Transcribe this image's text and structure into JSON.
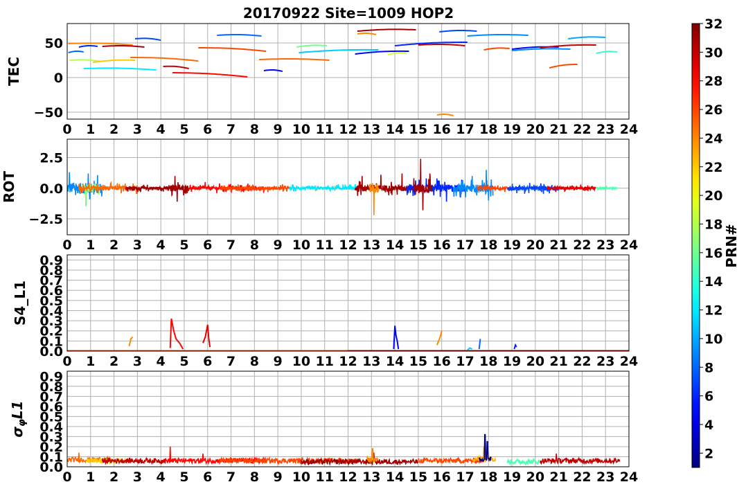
{
  "chart_data": {
    "type": "line",
    "title": "20170922 Site=1009 HOP2",
    "xlim": [
      0,
      24
    ],
    "x_ticks": [
      "0",
      "1",
      "2",
      "3",
      "4",
      "5",
      "6",
      "7",
      "8",
      "9",
      "10",
      "11",
      "12",
      "13",
      "14",
      "15",
      "16",
      "17",
      "18",
      "19",
      "20",
      "21",
      "22",
      "23",
      "24"
    ],
    "grid": true,
    "colorbar": {
      "label": "PRN#",
      "range": [
        1,
        32
      ],
      "ticks": [
        "2",
        "4",
        "6",
        "8",
        "10",
        "12",
        "14",
        "16",
        "18",
        "20",
        "22",
        "24",
        "26",
        "28",
        "30",
        "32"
      ],
      "colormap": "jet"
    },
    "panels": [
      {
        "ylabel": "TEC",
        "ylim": [
          -60,
          78
        ],
        "y_ticks": [
          {
            "v": 50,
            "label": "50"
          },
          {
            "v": 0,
            "label": "0"
          },
          {
            "v": -50,
            "label": "−50"
          }
        ],
        "series": [
          {
            "prn": 8,
            "x": [
              0.05,
              0.7
            ],
            "y": [
              36,
              37
            ]
          },
          {
            "prn": 18,
            "x": [
              0.1,
              1.5
            ],
            "y": [
              25,
              23
            ]
          },
          {
            "prn": 24,
            "x": [
              0.05,
              2.8
            ],
            "y": [
              49,
              47
            ]
          },
          {
            "prn": 6,
            "x": [
              0.5,
              1.3
            ],
            "y": [
              44,
              45
            ]
          },
          {
            "prn": 31,
            "x": [
              1.5,
              3.3
            ],
            "y": [
              45,
              44
            ]
          },
          {
            "prn": 12,
            "x": [
              0.7,
              3.8
            ],
            "y": [
              13,
              11
            ]
          },
          {
            "prn": 22,
            "x": [
              1.1,
              2.9
            ],
            "y": [
              22,
              25
            ]
          },
          {
            "prn": 7,
            "x": [
              2.9,
              4.0
            ],
            "y": [
              56,
              54
            ]
          },
          {
            "prn": 25,
            "x": [
              2.7,
              5.6
            ],
            "y": [
              29,
              24
            ]
          },
          {
            "prn": 30,
            "x": [
              4.1,
              5.2
            ],
            "y": [
              16,
              13
            ]
          },
          {
            "prn": 28,
            "x": [
              4.5,
              7.7
            ],
            "y": [
              7,
              1
            ]
          },
          {
            "prn": 26,
            "x": [
              5.6,
              8.5
            ],
            "y": [
              43,
              38
            ]
          },
          {
            "prn": 8,
            "x": [
              6.4,
              8.3
            ],
            "y": [
              61,
              60
            ]
          },
          {
            "prn": 5,
            "x": [
              8.4,
              9.2
            ],
            "y": [
              10,
              9
            ]
          },
          {
            "prn": 25,
            "x": [
              8.2,
              11.2
            ],
            "y": [
              26,
              25
            ]
          },
          {
            "prn": 16,
            "x": [
              9.8,
              11.1
            ],
            "y": [
              44,
              46
            ]
          },
          {
            "prn": 11,
            "x": [
              9.9,
              13.3
            ],
            "y": [
              36,
              40
            ]
          },
          {
            "prn": 5,
            "x": [
              12.3,
              14.6
            ],
            "y": [
              34,
              38
            ]
          },
          {
            "prn": 31,
            "x": [
              12.4,
              14.9
            ],
            "y": [
              67,
              69
            ]
          },
          {
            "prn": 24,
            "x": [
              12.4,
              13.2
            ],
            "y": [
              63,
              62
            ]
          },
          {
            "prn": 19,
            "x": [
              13.7,
              14.5
            ],
            "y": [
              33,
              35
            ]
          },
          {
            "prn": 6,
            "x": [
              14.0,
              17.1
            ],
            "y": [
              46,
              51
            ]
          },
          {
            "prn": 30,
            "x": [
              15.0,
              17.0
            ],
            "y": [
              47,
              46
            ]
          },
          {
            "prn": 7,
            "x": [
              15.9,
              17.5
            ],
            "y": [
              66,
              67
            ]
          },
          {
            "prn": 24,
            "x": [
              15.8,
              16.5
            ],
            "y": [
              -54,
              -55
            ]
          },
          {
            "prn": 9,
            "x": [
              17.1,
              19.7
            ],
            "y": [
              60,
              61
            ]
          },
          {
            "prn": 26,
            "x": [
              17.8,
              18.9
            ],
            "y": [
              40,
              42
            ]
          },
          {
            "prn": 5,
            "x": [
              19.0,
              21.0
            ],
            "y": [
              41,
              44
            ]
          },
          {
            "prn": 9,
            "x": [
              19.0,
              21.5
            ],
            "y": [
              39,
              41
            ]
          },
          {
            "prn": 30,
            "x": [
              20.2,
              22.6
            ],
            "y": [
              43,
              47
            ]
          },
          {
            "prn": 26,
            "x": [
              20.6,
              21.8
            ],
            "y": [
              14,
              19
            ]
          },
          {
            "prn": 10,
            "x": [
              21.4,
              23.0
            ],
            "y": [
              56,
              58
            ]
          },
          {
            "prn": 14,
            "x": [
              22.6,
              23.5
            ],
            "y": [
              35,
              37
            ]
          }
        ]
      },
      {
        "ylabel": "ROT",
        "ylim": [
          -3.8,
          4.0
        ],
        "y_ticks": [
          {
            "v": 2.5,
            "label": "2.5"
          },
          {
            "v": 0.0,
            "label": "0.0"
          },
          {
            "v": -2.5,
            "label": "−2.5"
          }
        ],
        "segments": [
          {
            "prn": 9,
            "x": [
              0.0,
              1.5
            ],
            "amp": 0.7,
            "spikes": [
              [
                0.1,
                1.3
              ],
              [
                0.9,
                1.2
              ],
              [
                0.8,
                -1.4
              ]
            ]
          },
          {
            "prn": 17,
            "x": [
              0.7,
              1.4
            ],
            "amp": 0.5,
            "spikes": [
              [
                0.8,
                -1.5
              ]
            ]
          },
          {
            "prn": 25,
            "x": [
              0.5,
              3.0
            ],
            "amp": 0.3,
            "spikes": []
          },
          {
            "prn": 31,
            "x": [
              2.5,
              4.6
            ],
            "amp": 0.2,
            "spikes": []
          },
          {
            "prn": 31,
            "x": [
              4.4,
              5.2
            ],
            "amp": 0.4,
            "spikes": [
              [
                4.6,
                1.0
              ],
              [
                4.7,
                -1.1
              ]
            ]
          },
          {
            "prn": 28,
            "x": [
              5.2,
              8.4
            ],
            "amp": 0.25,
            "spikes": [
              [
                5.9,
                0.5
              ]
            ]
          },
          {
            "prn": 26,
            "x": [
              6.5,
              9.5
            ],
            "amp": 0.2,
            "spikes": []
          },
          {
            "prn": 12,
            "x": [
              9.5,
              12.5
            ],
            "amp": 0.2,
            "spikes": []
          },
          {
            "prn": 31,
            "x": [
              12.3,
              14.9
            ],
            "amp": 0.4,
            "spikes": [
              [
                12.6,
                1.0
              ],
              [
                13.4,
                1.1
              ],
              [
                14.3,
                1.2
              ]
            ]
          },
          {
            "prn": 24,
            "x": [
              12.9,
              13.3
            ],
            "amp": 0.6,
            "spikes": [
              [
                13.1,
                -2.2
              ]
            ]
          },
          {
            "prn": 6,
            "x": [
              14.5,
              17.0
            ],
            "amp": 0.5,
            "spikes": [
              [
                15.2,
                -1.2
              ],
              [
                15.8,
                0.8
              ],
              [
                16.2,
                -1.1
              ]
            ]
          },
          {
            "prn": 31,
            "x": [
              14.8,
              15.6
            ],
            "amp": 0.6,
            "spikes": [
              [
                15.1,
                2.4
              ],
              [
                15.2,
                -1.8
              ],
              [
                15.5,
                1.2
              ]
            ]
          },
          {
            "prn": 9,
            "x": [
              16.5,
              18.2
            ],
            "amp": 0.5,
            "spikes": [
              [
                17.3,
                1.0
              ],
              [
                17.9,
                1.5
              ],
              [
                18.0,
                -1.0
              ]
            ]
          },
          {
            "prn": 26,
            "x": [
              17.5,
              19.0
            ],
            "amp": 0.2,
            "spikes": []
          },
          {
            "prn": 7,
            "x": [
              18.8,
              21.0
            ],
            "amp": 0.3,
            "spikes": []
          },
          {
            "prn": 29,
            "x": [
              20.5,
              22.6
            ],
            "amp": 0.2,
            "spikes": []
          },
          {
            "prn": 15,
            "x": [
              22.6,
              23.5
            ],
            "amp": 0.1,
            "spikes": []
          }
        ]
      },
      {
        "ylabel": "S4_L1",
        "ylim": [
          0.0,
          0.95
        ],
        "y_ticks": [
          {
            "v": 0.9,
            "label": "0.9"
          },
          {
            "v": 0.8,
            "label": "0.8"
          },
          {
            "v": 0.7,
            "label": "0.7"
          },
          {
            "v": 0.6,
            "label": "0.6"
          },
          {
            "v": 0.5,
            "label": "0.5"
          },
          {
            "v": 0.4,
            "label": "0.4"
          },
          {
            "v": 0.3,
            "label": "0.3"
          },
          {
            "v": 0.2,
            "label": "0.2"
          },
          {
            "v": 0.1,
            "label": "0.1"
          },
          {
            "v": 0.0,
            "label": "0.0"
          }
        ],
        "baseline": [
          {
            "prn": 26,
            "x": [
              0.0,
              12.0
            ]
          },
          {
            "prn": 30,
            "x": [
              12.0,
              24.0
            ]
          }
        ],
        "spikes": [
          {
            "prn": 24,
            "x": [
              2.65,
              2.72,
              2.8
            ],
            "y": [
              0.05,
              0.12,
              0.14
            ]
          },
          {
            "prn": 28,
            "x": [
              4.4,
              4.45,
              4.55,
              4.65,
              4.8,
              4.95
            ],
            "y": [
              0.03,
              0.32,
              0.2,
              0.12,
              0.08,
              0.02
            ]
          },
          {
            "prn": 29,
            "x": [
              5.8,
              5.9,
              6.0,
              6.05,
              6.1
            ],
            "y": [
              0.08,
              0.14,
              0.26,
              0.12,
              0.04
            ]
          },
          {
            "prn": 5,
            "x": [
              13.95,
              14.0,
              14.05,
              14.1,
              14.15
            ],
            "y": [
              0.02,
              0.25,
              0.15,
              0.1,
              0.02
            ]
          },
          {
            "prn": 24,
            "x": [
              15.8,
              15.95,
              16.0
            ],
            "y": [
              0.06,
              0.15,
              0.2
            ]
          },
          {
            "prn": 11,
            "x": [
              17.1,
              17.2,
              17.3
            ],
            "y": [
              0.01,
              0.03,
              0.02
            ]
          },
          {
            "prn": 8,
            "x": [
              17.6,
              17.65
            ],
            "y": [
              0.02,
              0.12
            ]
          },
          {
            "prn": 6,
            "x": [
              19.1,
              19.15,
              19.2
            ],
            "y": [
              0.02,
              0.06,
              0.04
            ]
          }
        ]
      },
      {
        "ylabel": "σφL1",
        "ylim": [
          0.0,
          0.95
        ],
        "y_ticks": [
          {
            "v": 0.9,
            "label": "0.9"
          },
          {
            "v": 0.8,
            "label": "0.8"
          },
          {
            "v": 0.7,
            "label": "0.7"
          },
          {
            "v": 0.6,
            "label": "0.6"
          },
          {
            "v": 0.5,
            "label": "0.5"
          },
          {
            "v": 0.4,
            "label": "0.4"
          },
          {
            "v": 0.3,
            "label": "0.3"
          },
          {
            "v": 0.2,
            "label": "0.2"
          },
          {
            "v": 0.1,
            "label": "0.1"
          },
          {
            "v": 0.0,
            "label": "0.0"
          }
        ],
        "segments": [
          {
            "prn": 25,
            "x": [
              0.0,
              1.8
            ],
            "level": 0.07,
            "spikes": [
              [
                0.5,
                0.14
              ]
            ]
          },
          {
            "prn": 22,
            "x": [
              0.8,
              2.5
            ],
            "level": 0.06,
            "spikes": []
          },
          {
            "prn": 30,
            "x": [
              1.5,
              4.2
            ],
            "level": 0.06,
            "spikes": []
          },
          {
            "prn": 28,
            "x": [
              4.2,
              8.5
            ],
            "level": 0.06,
            "spikes": [
              [
                4.4,
                0.2
              ],
              [
                5.8,
                0.13
              ]
            ]
          },
          {
            "prn": 26,
            "x": [
              6.5,
              12.5
            ],
            "level": 0.06,
            "spikes": []
          },
          {
            "prn": 31,
            "x": [
              10.0,
              15.0
            ],
            "level": 0.05,
            "spikes": [
              [
                13.1,
                0.14
              ]
            ]
          },
          {
            "prn": 24,
            "x": [
              12.8,
              13.3
            ],
            "level": 0.07,
            "spikes": [
              [
                13.05,
                0.18
              ]
            ]
          },
          {
            "prn": 26,
            "x": [
              15.0,
              17.8
            ],
            "level": 0.06,
            "spikes": []
          },
          {
            "prn": 23,
            "x": [
              17.3,
              18.3
            ],
            "level": 0.08,
            "spikes": [
              [
                17.8,
                0.2
              ],
              [
                18.0,
                0.16
              ]
            ]
          },
          {
            "prn": 1,
            "x": [
              17.6,
              18.1
            ],
            "level": 0.08,
            "spikes": [
              [
                17.85,
                0.32
              ],
              [
                17.95,
                0.25
              ]
            ]
          },
          {
            "prn": 15,
            "x": [
              18.8,
              20.2
            ],
            "level": 0.05,
            "spikes": []
          },
          {
            "prn": 30,
            "x": [
              20.2,
              23.6
            ],
            "level": 0.06,
            "spikes": [
              [
                20.9,
                0.13
              ]
            ]
          }
        ]
      }
    ]
  }
}
